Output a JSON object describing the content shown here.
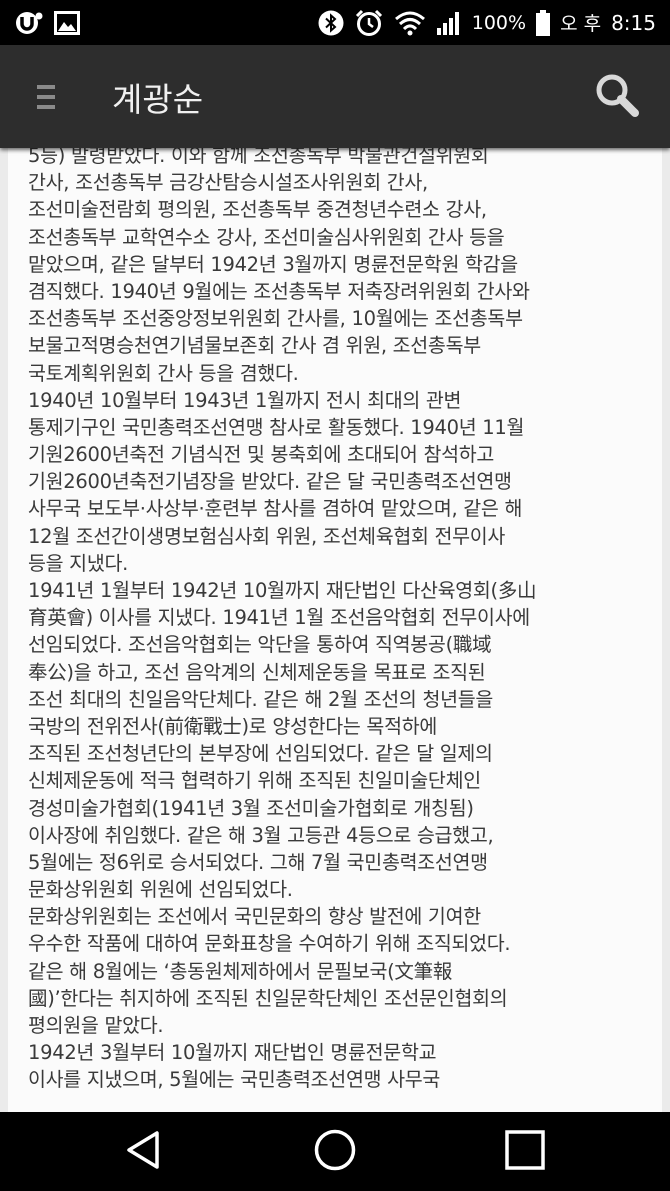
{
  "status_bar": {
    "battery": "100%",
    "ampm": "오 후",
    "time": "8:15",
    "icons": [
      "uplus-icon",
      "gallery-icon",
      "bluetooth-icon",
      "alarm-icon",
      "wifi-icon",
      "signal-icon",
      "battery-icon"
    ]
  },
  "app_bar": {
    "title": "계광순",
    "menu_icon": "hamburger-menu-icon",
    "search_icon": "search-icon"
  },
  "article": {
    "lines": [
      "5등) 발령받았다. 이와 함께 조선총독부 박물관건설위원회",
      "간사, 조선총독부 금강산탐승시설조사위원회 간사,",
      "조선미술전람회 평의원, 조선총독부 중견청년수련소 강사,",
      "조선총독부 교학연수소 강사, 조선미술심사위원회 간사 등을",
      "맡았으며, 같은 달부터 1942년 3월까지 명륜전문학원 학감을",
      "겸직했다. 1940년 9월에는 조선총독부 저축장려위원회 간사와",
      "조선총독부 조선중앙정보위원회 간사를, 10월에는 조선총독부",
      "보물고적명승천연기념물보존회 간사 겸 위원, 조선총독부",
      "국토계획위원회 간사 등을 겸했다.",
      "1940년 10월부터 1943년 1월까지 전시 최대의 관변",
      "통제기구인 국민총력조선연맹 참사로 활동했다. 1940년 11월",
      "기원2600년축전 기념식전 및 봉축회에 초대되어 참석하고",
      "기원2600년축전기념장을 받았다. 같은 달 국민총력조선연맹",
      "사무국 보도부·사상부·훈련부 참사를 겸하여 맡았으며, 같은 해",
      "12월 조선간이생명보험심사회 위원, 조선체육협회 전무이사",
      "등을 지냈다.",
      "1941년 1월부터 1942년 10월까지 재단법인 다산육영회(多山",
      "育英會) 이사를 지냈다. 1941년 1월 조선음악협회 전무이사에",
      "선임되었다. 조선음악협회는 악단을 통하여 직역봉공(職域",
      "奉公)을 하고, 조선 음악계의 신체제운동을 목표로 조직된",
      "조선 최대의 친일음악단체다. 같은 해 2월 조선의 청년들을",
      "국방의 전위전사(前衛戰士)로 양성한다는 목적하에",
      "조직된 조선청년단의 본부장에 선임되었다. 같은 달 일제의",
      "신체제운동에 적극 협력하기 위해 조직된 친일미술단체인",
      "경성미술가협회(1941년 3월 조선미술가협회로 개칭됨)",
      "이사장에 취임했다. 같은 해 3월 고등관 4등으로 승급했고,",
      "5월에는 정6위로 승서되었다. 그해 7월 국민총력조선연맹",
      "문화상위원회 위원에 선임되었다.",
      "문화상위원회는 조선에서 국민문화의 향상 발전에 기여한",
      "우수한 작품에 대하여 문화표창을 수여하기 위해 조직되었다.",
      "같은 해 8월에는 ‘총동원체제하에서 문필보국(文筆報",
      "國)’한다는 취지하에 조직된 친일문학단체인 조선문인협회의",
      "평의원을 맡았다.",
      "1942년 3월부터 10월까지 재단법인 명륜전문학교",
      "이사를 지냈으며, 5월에는 국민총력조선연맹 사무국"
    ]
  },
  "nav_bar": {
    "back_icon": "back-triangle-icon",
    "home_icon": "home-circle-icon",
    "recents_icon": "recents-square-icon"
  }
}
